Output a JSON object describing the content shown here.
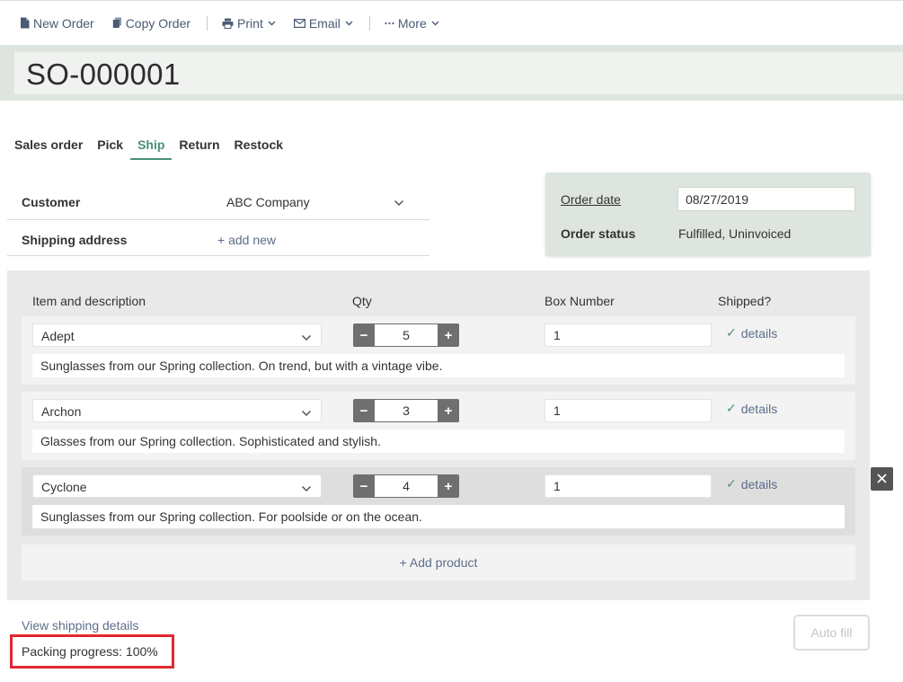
{
  "toolbar": {
    "new_order": "New Order",
    "copy_order": "Copy Order",
    "print": "Print",
    "email": "Email",
    "more": "More"
  },
  "order": {
    "number": "SO-000001"
  },
  "tabs": [
    {
      "label": "Sales order",
      "active": false
    },
    {
      "label": "Pick",
      "active": false
    },
    {
      "label": "Ship",
      "active": true
    },
    {
      "label": "Return",
      "active": false
    },
    {
      "label": "Restock",
      "active": false
    }
  ],
  "customer": {
    "label": "Customer",
    "value": "ABC Company"
  },
  "shipping_address": {
    "label": "Shipping address",
    "add_new": "+ add new"
  },
  "order_info": {
    "date_label": "Order date",
    "date_value": "08/27/2019",
    "status_label": "Order status",
    "status_value": "Fulfilled, Uninvoiced"
  },
  "columns": {
    "item": "Item and description",
    "qty": "Qty",
    "box": "Box Number",
    "shipped": "Shipped?"
  },
  "items": [
    {
      "name": "Adept",
      "qty": "5",
      "box": "1",
      "shipped_check": "✓",
      "details": "details",
      "description": "Sunglasses from our Spring collection. On trend, but with a vintage vibe."
    },
    {
      "name": "Archon",
      "qty": "3",
      "box": "1",
      "shipped_check": "✓",
      "details": "details",
      "description": "Glasses from our Spring collection. Sophisticated and stylish."
    },
    {
      "name": "Cyclone",
      "qty": "4",
      "box": "1",
      "shipped_check": "✓",
      "details": "details",
      "description": "Sunglasses from our Spring collection. For poolside or on the ocean."
    }
  ],
  "add_product": "+ Add product",
  "view_shipping_details": "View shipping details",
  "packing_progress": "Packing progress: 100%",
  "auto_fill": "Auto fill",
  "colors": {
    "accent": "#4a8f78",
    "link": "#5c6e8a",
    "highlight_box": "#e0292f",
    "panel_green": "#dde5de"
  }
}
